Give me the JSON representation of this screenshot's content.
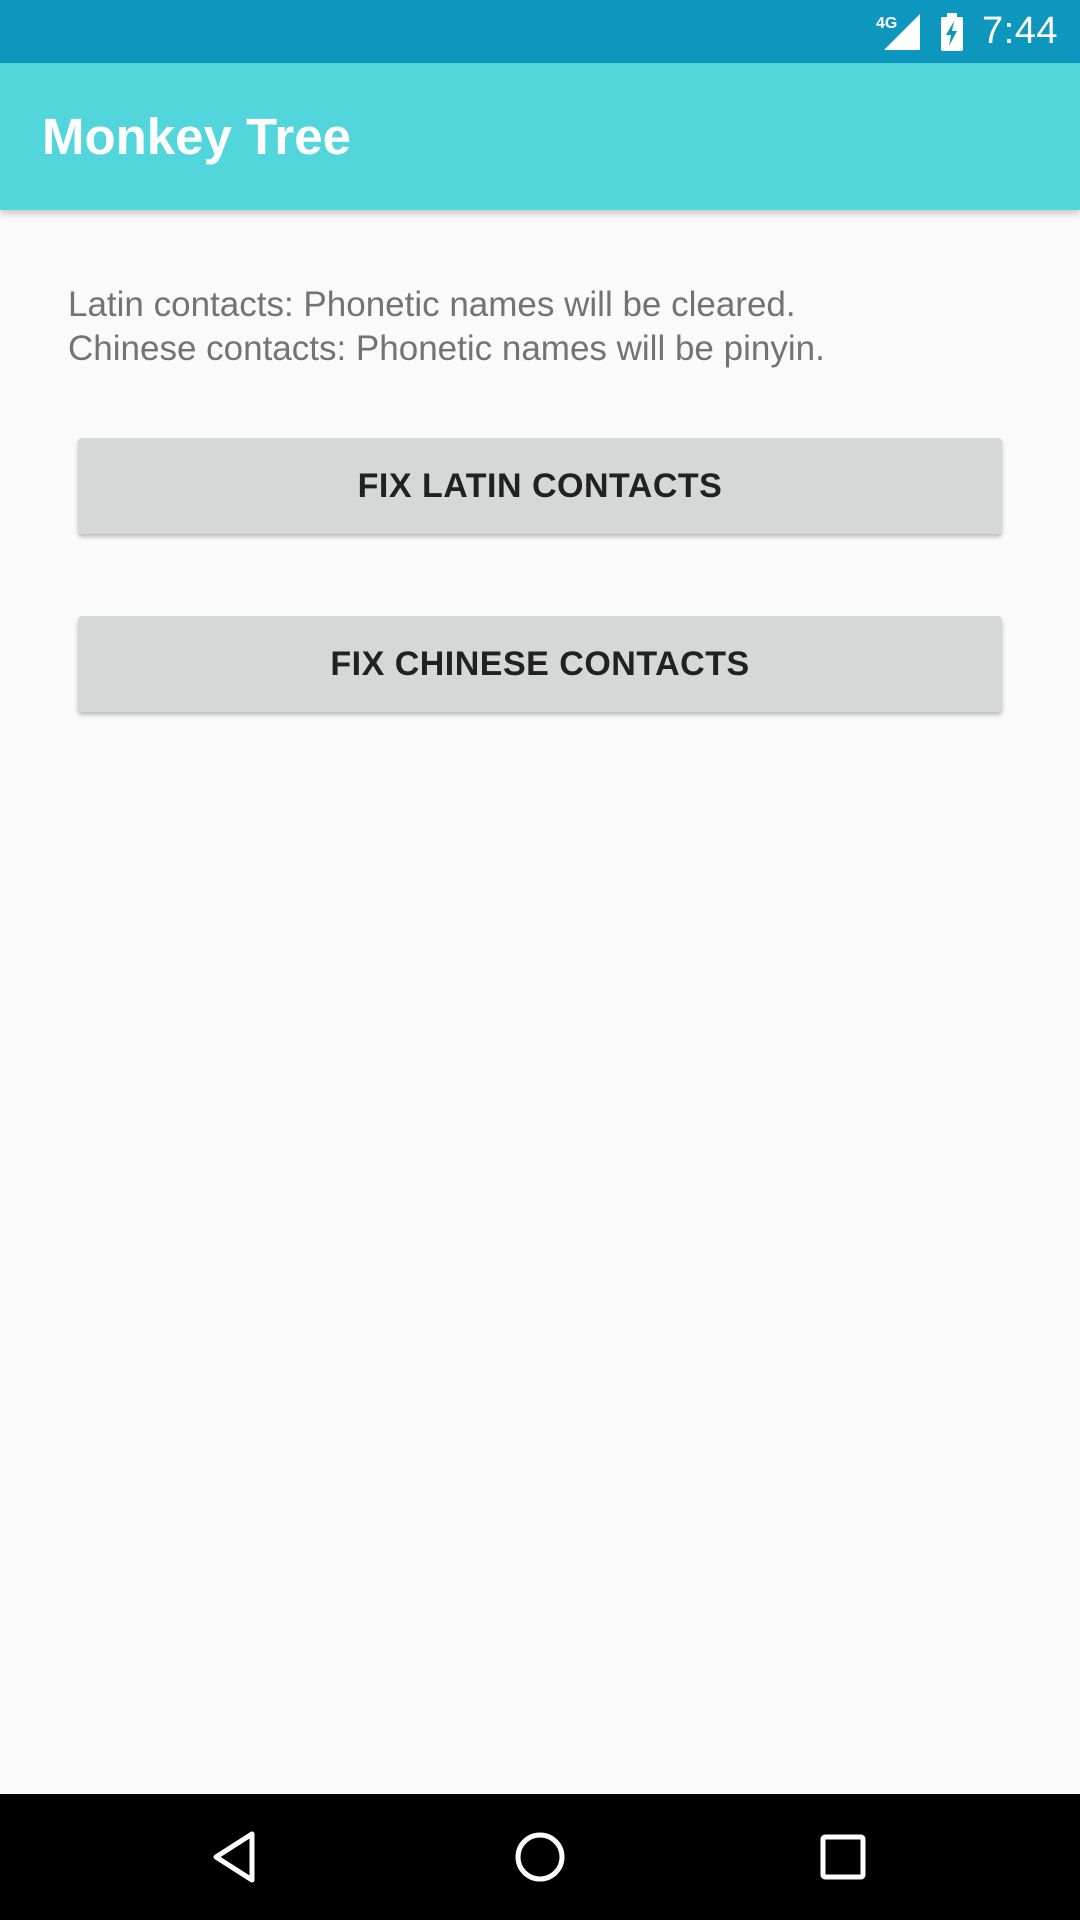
{
  "status_bar": {
    "network_label": "4G",
    "time": "7:44",
    "background_color": "#0d97bf",
    "icons": [
      "signal-icon",
      "battery-charging-icon"
    ]
  },
  "app_bar": {
    "title": "Monkey Tree",
    "background_color": "#52d6dc"
  },
  "main": {
    "info_lines": [
      "Latin contacts: Phonetic names will be cleared.",
      "Chinese contacts: Phonetic names will be pinyin."
    ],
    "buttons": {
      "fix_latin": "FIX LATIN CONTACTS",
      "fix_chinese": "FIX CHINESE CONTACTS"
    }
  },
  "nav_bar": {
    "icons": [
      "back-icon",
      "home-icon",
      "recents-icon"
    ]
  }
}
